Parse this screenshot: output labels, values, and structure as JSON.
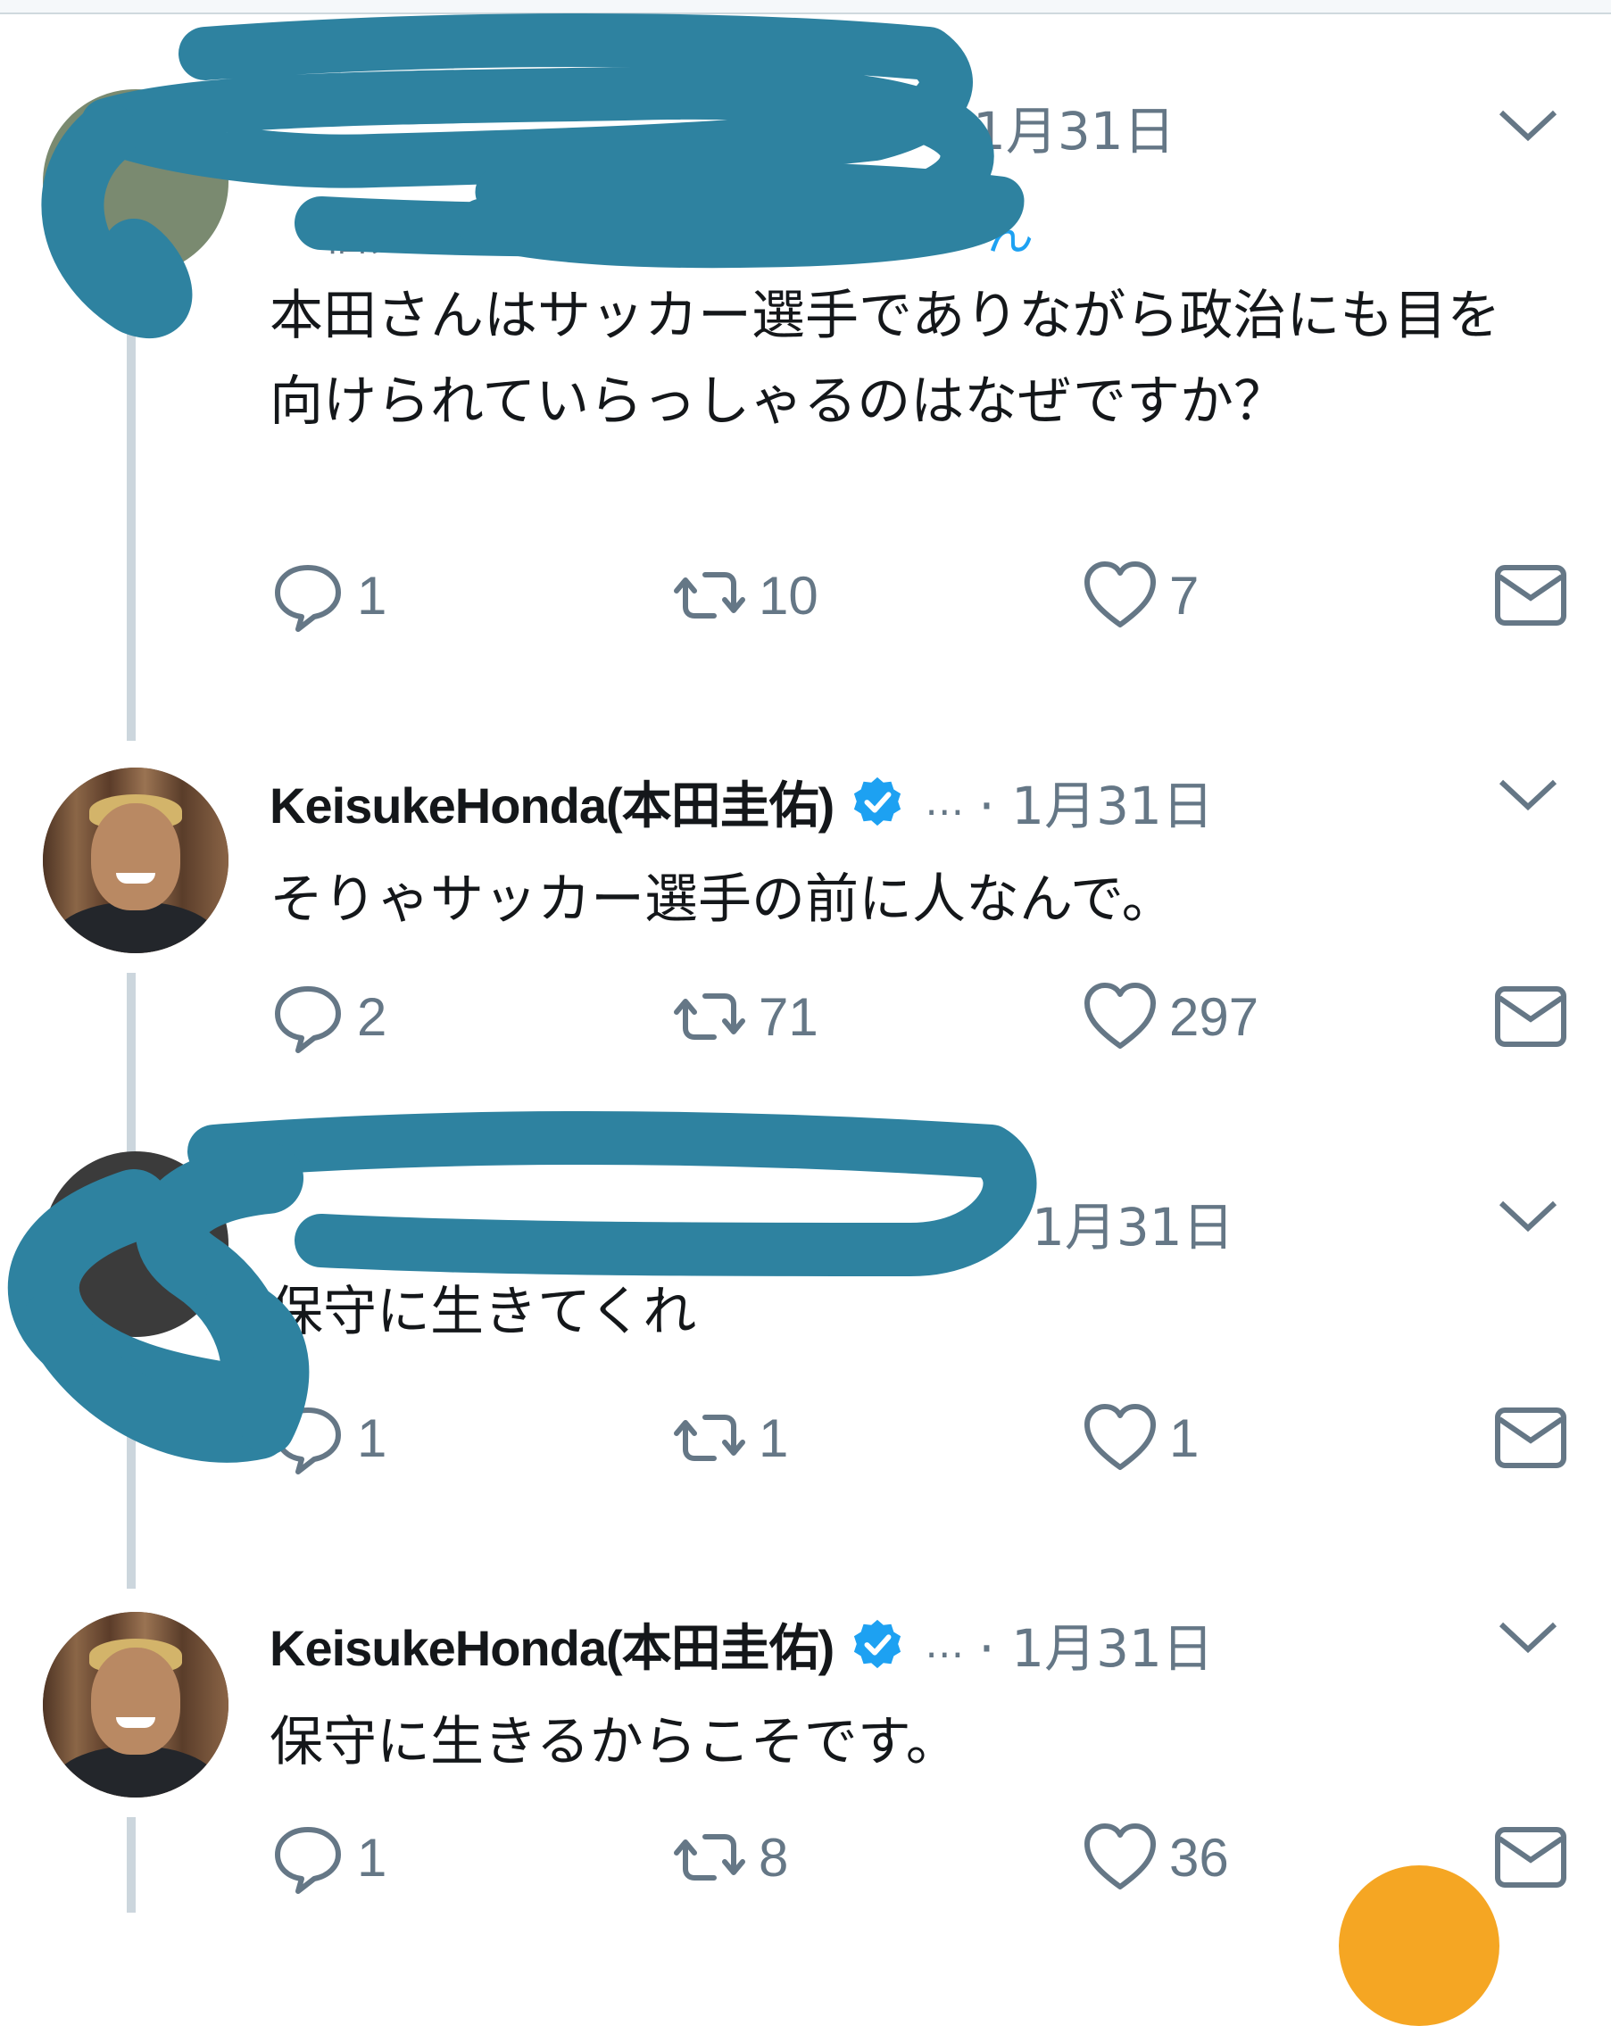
{
  "tweets": [
    {
      "date": "1月31日",
      "reply_prefix": "信先",
      "reply_tail": "ん",
      "text": "本田さんはサッカー選手でありながら政治にも目を向けられていらっしゃるのはなぜですか？",
      "replies": "1",
      "retweets": "10",
      "likes": "7"
    },
    {
      "display_name": "KeisukeHonda(本田圭佑)",
      "dots": "…",
      "date": "· 1月31日",
      "text": "そりゃサッカー選手の前に人なんで。",
      "replies": "2",
      "retweets": "71",
      "likes": "297"
    },
    {
      "date": "1月31日",
      "text": "保守に生きてくれ",
      "replies": "1",
      "retweets": "1",
      "likes": "1"
    },
    {
      "display_name": "KeisukeHonda(本田圭佑)",
      "dots": "…",
      "date": "· 1月31日",
      "text": "保守に生きるからこそです。",
      "replies": "1",
      "retweets": "8",
      "likes": "36"
    }
  ],
  "icons": {
    "reply": "speech-bubble-icon",
    "retweet": "retweet-arrows-icon",
    "like": "heart-icon",
    "dm": "envelope-icon",
    "more": "chevron-down-icon",
    "verified": "verified-badge-icon"
  },
  "colors": {
    "accent": "#1da1f2",
    "muted": "#657786",
    "thread_line": "#ccd6dd",
    "redaction": "#2e82a0",
    "fab": "#f5a623"
  }
}
